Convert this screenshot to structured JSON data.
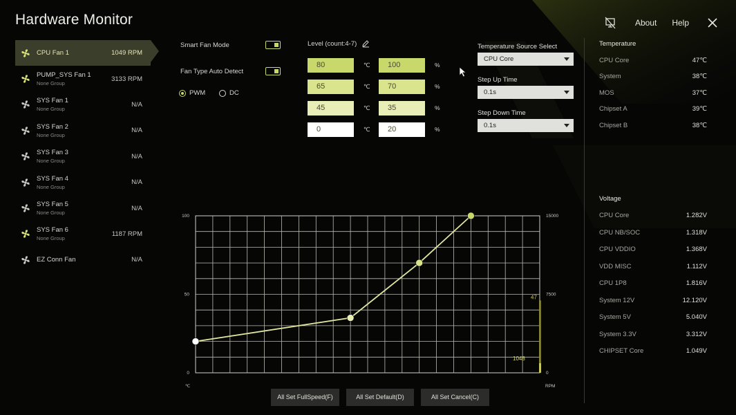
{
  "app": {
    "title": "Hardware Monitor"
  },
  "topbar": {
    "about_label": "About",
    "help_label": "Help"
  },
  "fans": [
    {
      "name": "CPU Fan 1",
      "group": "",
      "speed": "1049 RPM",
      "active": true
    },
    {
      "name": "PUMP_SYS Fan 1",
      "group": "None Group",
      "speed": "3133 RPM"
    },
    {
      "name": "SYS Fan 1",
      "group": "None Group",
      "speed": "N/A"
    },
    {
      "name": "SYS Fan 2",
      "group": "None Group",
      "speed": "N/A"
    },
    {
      "name": "SYS Fan 3",
      "group": "None Group",
      "speed": "N/A"
    },
    {
      "name": "SYS Fan 4",
      "group": "None Group",
      "speed": "N/A"
    },
    {
      "name": "SYS Fan 5",
      "group": "None Group",
      "speed": "N/A"
    },
    {
      "name": "SYS Fan 6",
      "group": "None Group",
      "speed": "1187 RPM"
    },
    {
      "name": "EZ Conn Fan",
      "group": "",
      "speed": "N/A"
    }
  ],
  "controls": {
    "smart_fan_mode_label": "Smart Fan Mode",
    "smart_fan_mode_on": true,
    "fan_type_auto_label": "Fan Type Auto Detect",
    "fan_type_auto_on": true,
    "pwm_label": "PWM",
    "dc_label": "DC",
    "selected_type": "PWM"
  },
  "levels": {
    "label": "Level (count:4-7)",
    "temp_unit": "℃",
    "pct_unit": "%",
    "rows": [
      {
        "temp": "80",
        "pct": "100",
        "color": "#c8d86a"
      },
      {
        "temp": "65",
        "pct": "70",
        "color": "#d9e48c"
      },
      {
        "temp": "45",
        "pct": "35",
        "color": "#e8eeb6"
      },
      {
        "temp": "0",
        "pct": "20",
        "color": "#ffffff"
      }
    ]
  },
  "source": {
    "temp_source_label": "Temperature Source Select",
    "temp_source_value": "CPU Core",
    "step_up_label": "Step Up Time",
    "step_up_value": "0.1s",
    "step_down_label": "Step Down Time",
    "step_down_value": "0.1s"
  },
  "temperature": {
    "title": "Temperature",
    "items": [
      {
        "label": "CPU Core",
        "value": "47℃"
      },
      {
        "label": "System",
        "value": "38℃"
      },
      {
        "label": "MOS",
        "value": "37℃"
      },
      {
        "label": "Chipset A",
        "value": "39℃"
      },
      {
        "label": "Chipset B",
        "value": "38℃"
      }
    ]
  },
  "voltage": {
    "title": "Voltage",
    "items": [
      {
        "label": "CPU Core",
        "value": "1.282V"
      },
      {
        "label": "CPU NB/SOC",
        "value": "1.318V"
      },
      {
        "label": "CPU VDDIO",
        "value": "1.368V"
      },
      {
        "label": "VDD MISC",
        "value": "1.112V"
      },
      {
        "label": "CPU 1P8",
        "value": "1.816V"
      },
      {
        "label": "System 12V",
        "value": "12.120V"
      },
      {
        "label": "System 5V",
        "value": "5.040V"
      },
      {
        "label": "System 3.3V",
        "value": "3.312V"
      },
      {
        "label": "CHIPSET Core",
        "value": "1.049V"
      }
    ]
  },
  "chart_data": {
    "type": "line",
    "x_unit": "℃",
    "y2_unit": "RPM",
    "y_ticks": [
      "100",
      "50",
      "0"
    ],
    "y2_ticks": [
      "15000",
      "7500",
      "0"
    ],
    "xlim": [
      0,
      100
    ],
    "ylim": [
      0,
      100
    ],
    "y2lim": [
      0,
      15000
    ],
    "grid": true,
    "series": [
      {
        "points": [
          [
            0,
            20
          ],
          [
            45,
            35
          ],
          [
            65,
            70
          ],
          [
            80,
            100
          ]
        ]
      }
    ],
    "current_temp_label": "47",
    "current_rpm_label": "1048",
    "current_temp": 47,
    "current_rpm": 1048
  },
  "buttons": {
    "full_speed": "All Set FullSpeed(F)",
    "default": "All Set Default(D)",
    "cancel": "All Set Cancel(C)"
  },
  "colors": {
    "accent": "#c8d86a",
    "background": "#060605",
    "panel": "#3a3e2a"
  }
}
